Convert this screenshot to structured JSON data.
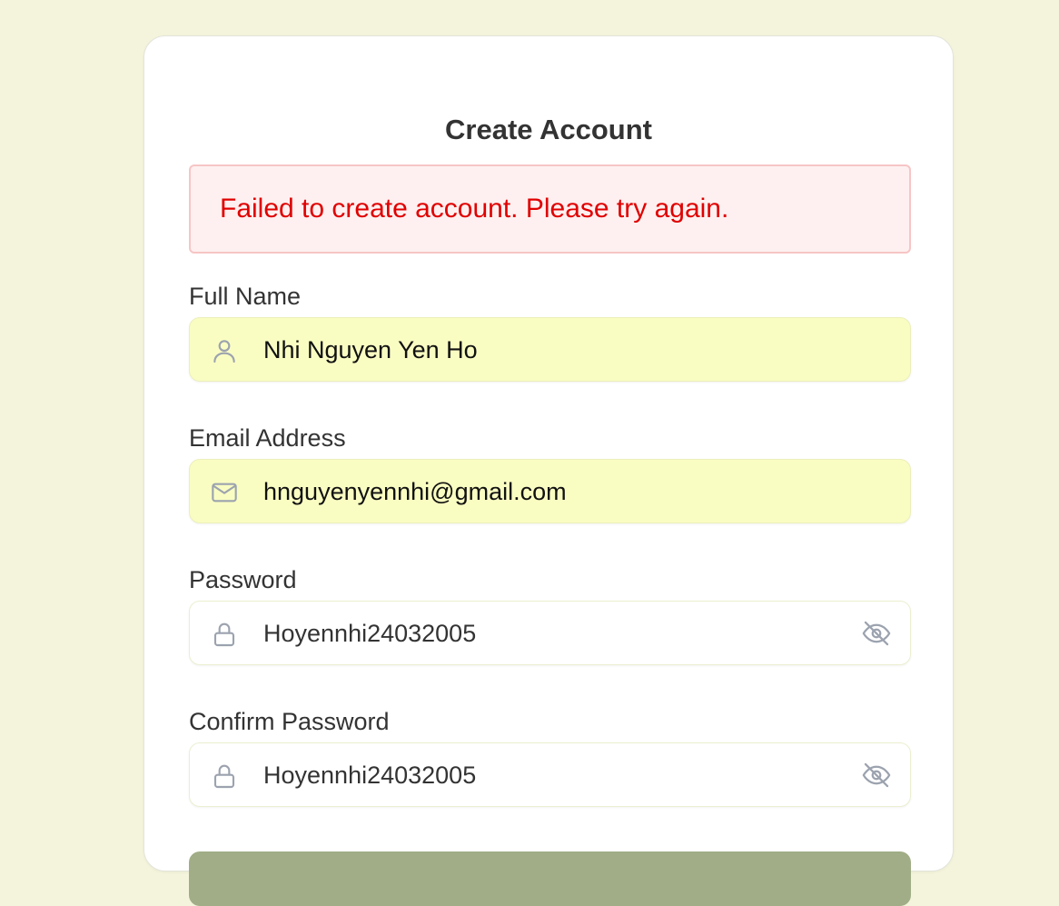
{
  "form": {
    "title": "Create Account",
    "error_message": "Failed to create account. Please try again.",
    "full_name": {
      "label": "Full Name",
      "value": "Nhi Nguyen Yen Ho",
      "icon": "user-icon"
    },
    "email": {
      "label": "Email Address",
      "value": "hnguyenyennhi@gmail.com",
      "icon": "mail-icon"
    },
    "password": {
      "label": "Password",
      "value": "Hoyennhi24032005",
      "icon": "lock-icon",
      "toggle_icon": "eye-off-icon"
    },
    "confirm_password": {
      "label": "Confirm Password",
      "value": "Hoyennhi24032005",
      "icon": "lock-icon",
      "toggle_icon": "eye-off-icon"
    }
  },
  "colors": {
    "page_background": "#f4f4dc",
    "error_text": "#e00000",
    "error_background": "#fef0f0",
    "autofill_background": "#fafdc2",
    "submit_button": "#a0ad86"
  }
}
